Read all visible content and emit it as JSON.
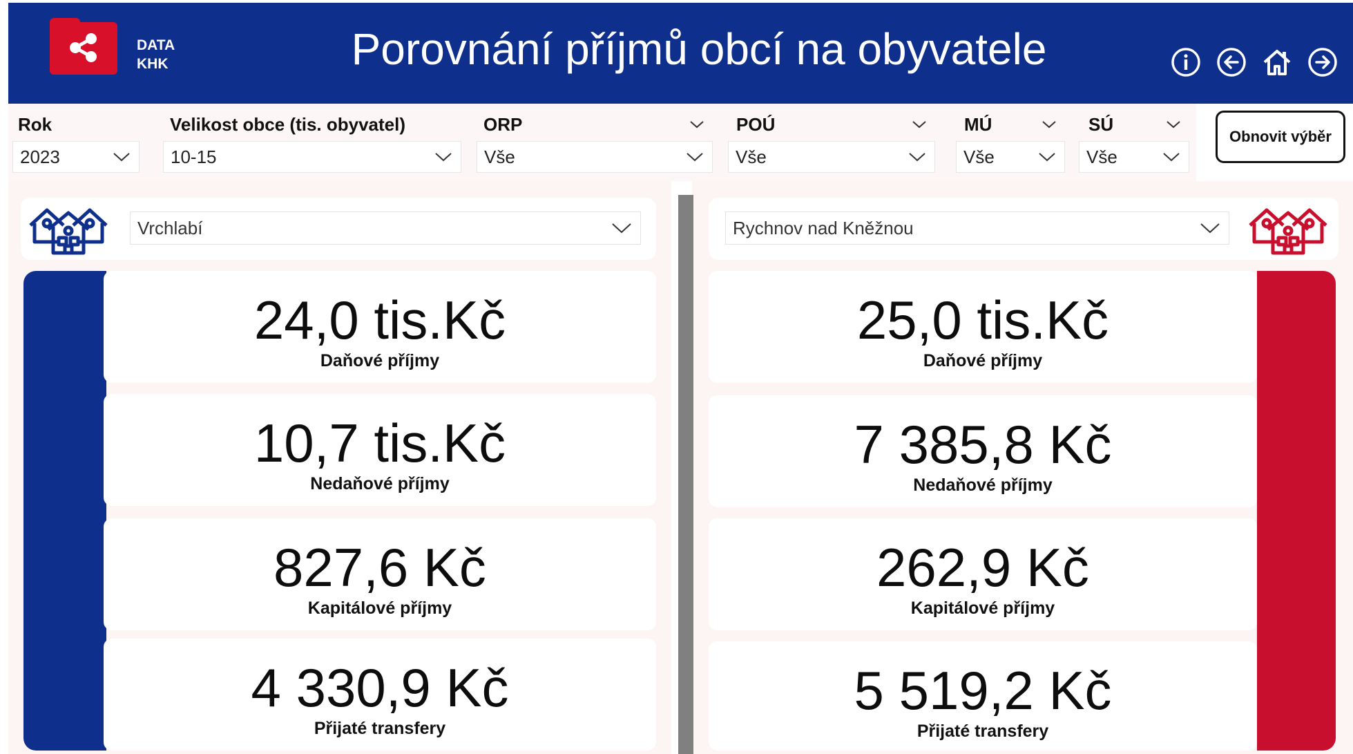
{
  "header": {
    "logo_line1": "DATA",
    "logo_line2": "KHK",
    "title": "Porovnání příjmů obcí na obyvatele",
    "icons": [
      "info-icon",
      "arrow-left-icon",
      "home-icon",
      "arrow-right-icon"
    ],
    "background": "#0f2f8c",
    "logo_color": "#d8102a"
  },
  "filters": {
    "rok": {
      "label": "Rok",
      "value": "2023"
    },
    "velikost": {
      "label": "Velikost obce (tis. obyvatel)",
      "value": "10-15"
    },
    "orp": {
      "label": "ORP",
      "value": "Vše"
    },
    "pou": {
      "label": "POÚ",
      "value": "Vše"
    },
    "mu": {
      "label": "MÚ",
      "value": "Vše"
    },
    "su": {
      "label": "SÚ",
      "value": "Vše"
    },
    "reset_label": "Obnovit výběr"
  },
  "left": {
    "town": "Vrchlabí",
    "accent": "#0f2f8c",
    "kpis": [
      {
        "value": "24,0 tis.Kč",
        "label": "Daňové příjmy"
      },
      {
        "value": "10,7 tis.Kč",
        "label": "Nedaňové příjmy"
      },
      {
        "value": "827,6 Kč",
        "label": "Kapitálové příjmy"
      },
      {
        "value": "4 330,9 Kč",
        "label": "Přijaté transfery"
      }
    ]
  },
  "right": {
    "town": "Rychnov nad Kněžnou",
    "accent": "#c8102e",
    "kpis": [
      {
        "value": "25,0 tis.Kč",
        "label": "Daňové příjmy"
      },
      {
        "value": "7 385,8 Kč",
        "label": "Nedaňové příjmy"
      },
      {
        "value": "262,9 Kč",
        "label": "Kapitálové příjmy"
      },
      {
        "value": "5 519,2 Kč",
        "label": "Přijaté transfery"
      }
    ]
  }
}
